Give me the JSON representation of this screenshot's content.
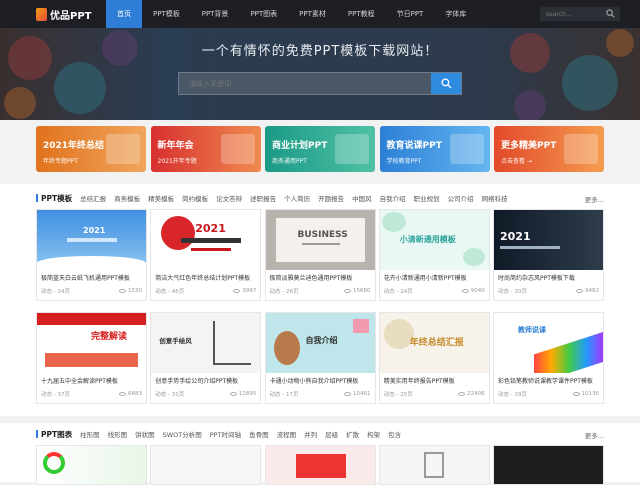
{
  "nav": {
    "logo_text": "优品PPT",
    "items": [
      {
        "label": "首页",
        "active": true
      },
      {
        "label": "PPT模板"
      },
      {
        "label": "PPT背景"
      },
      {
        "label": "PPT图表"
      },
      {
        "label": "PPT素材"
      },
      {
        "label": "PPT教程"
      },
      {
        "label": "节日PPT"
      },
      {
        "label": "字体库"
      }
    ],
    "search_placeholder": "search...",
    "search_icon": "search-icon"
  },
  "hero": {
    "title": "一个有情怀的免费PPT模板下载网站！",
    "search_placeholder": "请输入关键词",
    "search_icon": "search-icon"
  },
  "banners": [
    {
      "title": "2021年终总结",
      "sub": "年终专题PPT",
      "color": "#e0721d"
    },
    {
      "title": "新年年会",
      "sub": "2021开年专题",
      "color": "#d72f2f"
    },
    {
      "title": "商业计划PPT",
      "sub": "商务通用PPT",
      "color": "#1b9a86"
    },
    {
      "title": "教育说课PPT",
      "sub": "学校教育PPT",
      "color": "#2b7fd6"
    },
    {
      "title": "更多精美PPT",
      "sub": "点击查看 →",
      "color": "#e24a2b"
    }
  ],
  "ppt_section": {
    "title": "PPT模板",
    "categories": [
      "总结汇报",
      "商务模板",
      "精美模板",
      "简约模板",
      "论文答辩",
      "述职报告",
      "个人简历",
      "开题报告",
      "中国风",
      "自我介绍",
      "职业规划",
      "公司介绍",
      "网络科技"
    ],
    "more": "更多..."
  },
  "cards_row1": [
    {
      "title": "极简蓝天白云纸飞机通用PPT模板",
      "pages": "动态 - 24页",
      "views": "1530",
      "thumb_text": "2021"
    },
    {
      "title": "简洁大气红色年终总结计划PPT模板",
      "pages": "动态 - 45页",
      "views": "3997",
      "thumb_text": "2021"
    },
    {
      "title": "极简淡雅莫兰迪色通用PPT模板",
      "pages": "动态 - 26页",
      "views": "15680",
      "thumb_text": "BUSINESS"
    },
    {
      "title": "花卉小清新通用小清新PPT模板",
      "pages": "动态 - 24页",
      "views": "9040",
      "thumb_text": "小清新通用模板"
    },
    {
      "title": "时尚简约杂志风PPT模板下载",
      "pages": "动态 - 20页",
      "views": "9482",
      "thumb_text": "2021"
    }
  ],
  "cards_row2": [
    {
      "title": "十九届五中全会解读PPT模板",
      "pages": "动态 - 37页",
      "views": "6683",
      "thumb_text": "完整解读"
    },
    {
      "title": "创意手势手绘公司介绍PPT模板",
      "pages": "动态 - 31页",
      "views": "11895",
      "thumb_text": "创意手绘风"
    },
    {
      "title": "卡通小动物小熊自我介绍PPT模板",
      "pages": "动态 - 17页",
      "views": "10461",
      "thumb_text": "自我介绍"
    },
    {
      "title": "精美实用年终报告PPT模板",
      "pages": "动态 - 25页",
      "views": "22406",
      "thumb_text": "年终总结汇报"
    },
    {
      "title": "彩色铅笔教师说课教学课件PPT模板",
      "pages": "动态 - 29页",
      "views": "10136",
      "thumb_text": "教师说课"
    }
  ],
  "chart_section": {
    "title": "PPT图表",
    "categories": [
      "柱形图",
      "线形图",
      "饼状图",
      "SWOT分析图",
      "PPT时间轴",
      "鱼骨图",
      "流程图",
      "并列",
      "层级",
      "扩散",
      "构架",
      "包含"
    ],
    "more": "更多..."
  }
}
